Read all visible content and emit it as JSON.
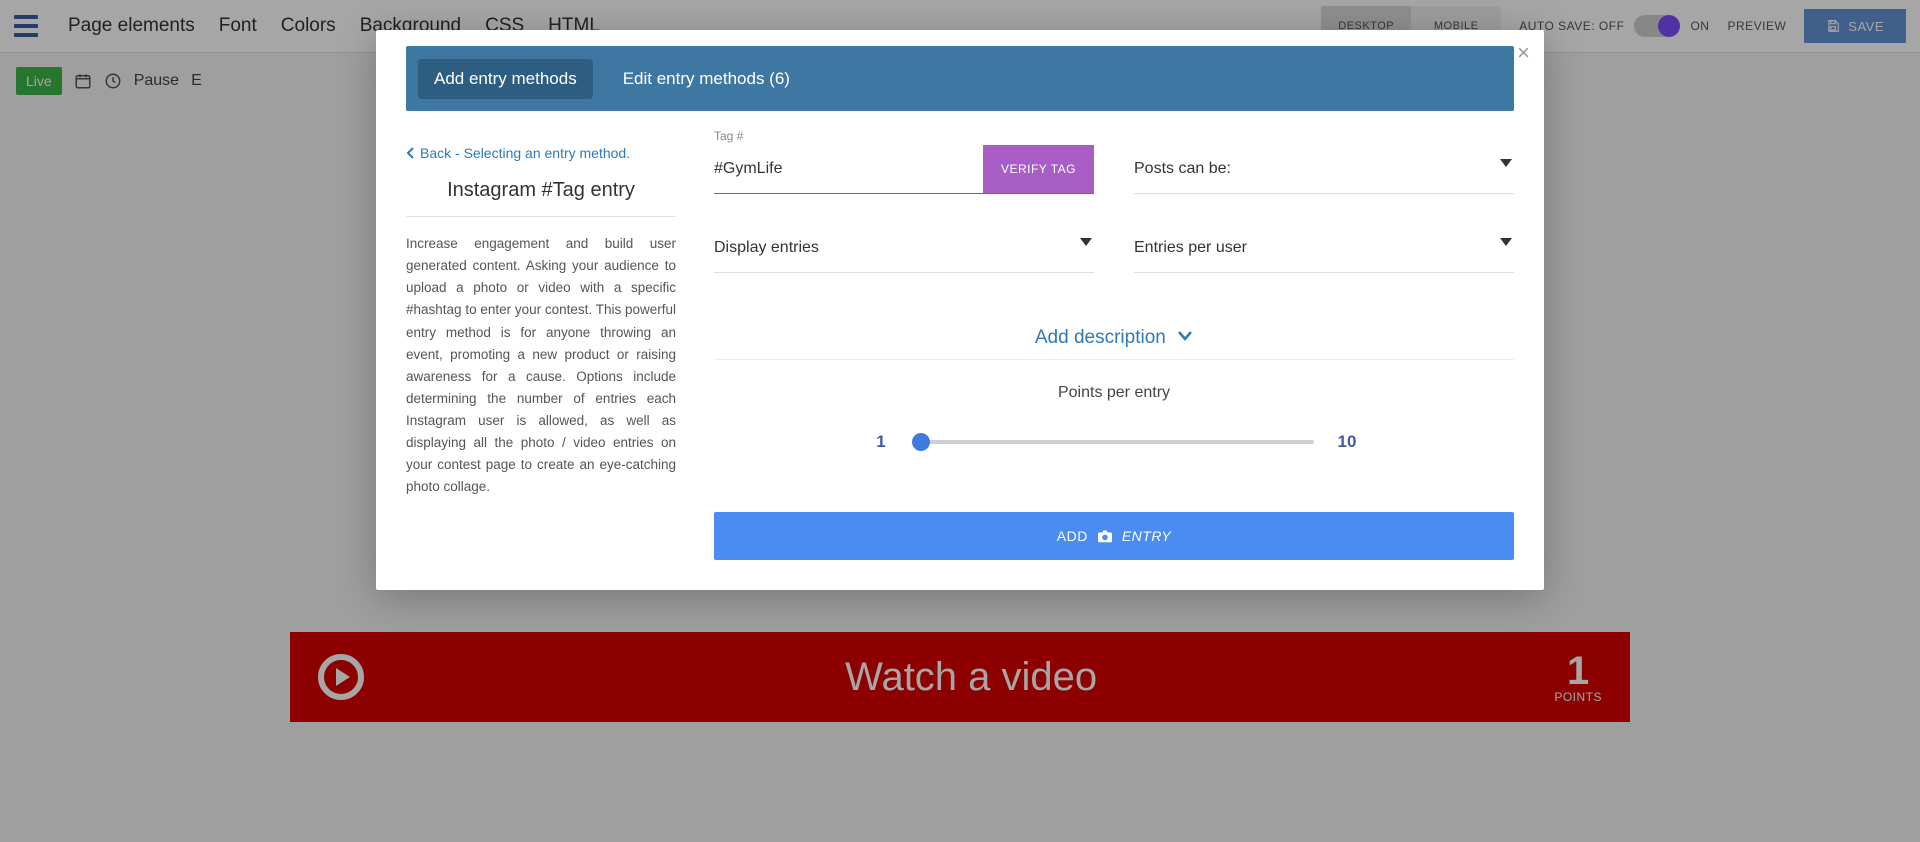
{
  "topbar": {
    "nav": [
      "Page elements",
      "Font",
      "Colors",
      "Background",
      "CSS",
      "HTML"
    ],
    "device": {
      "desktop": "DESKTOP",
      "mobile": "MOBILE"
    },
    "autosave_label": "AUTO SAVE: OFF",
    "autosave_on": "ON",
    "preview": "PREVIEW",
    "save": "SAVE"
  },
  "subbar": {
    "live": "Live",
    "items": [
      "Pause",
      "E"
    ]
  },
  "video_bar": {
    "title": "Watch a video",
    "points_value": "1",
    "points_label": "POINTS"
  },
  "modal": {
    "tabs": {
      "add": "Add entry methods",
      "edit": "Edit entry methods (6)"
    },
    "back": "Back - Selecting an entry method.",
    "heading": "Instagram #Tag entry",
    "description": "Increase engagement and build user generated content. Asking your audience to upload a photo or video with a specific #hashtag to enter your contest. This powerful entry method is for anyone throwing an event, promoting a new product or raising awareness for a cause. Options include determining the number of entries each Instagram user is allowed, as well as displaying all the photo / video entries on your contest page to create an eye-catching photo collage.",
    "fields": {
      "tag_label": "Tag #",
      "tag_value": "#GymLife",
      "verify": "VERIFY TAG",
      "posts_label": "Posts can be:",
      "display_entries_label": "Display entries",
      "entries_per_user_label": "Entries per user"
    },
    "desc_link": "Add description",
    "points_per_entry": "Points per entry",
    "slider": {
      "min": "1",
      "max": "10"
    },
    "add_btn": {
      "prefix": "ADD",
      "suffix": "ENTRY"
    }
  }
}
